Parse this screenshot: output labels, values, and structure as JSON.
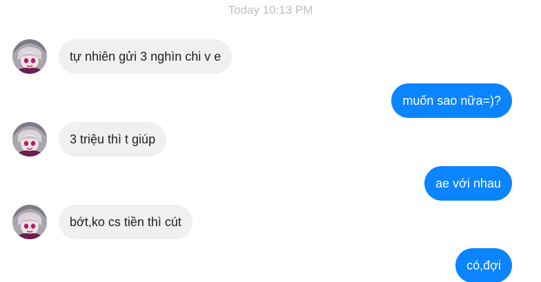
{
  "conversation": {
    "timestamp": "Today 10:13 PM",
    "colors": {
      "incoming_bubble": "#f1f0f0",
      "outgoing_bubble": "#0a84ff",
      "timestamp_text": "#bcc0c4"
    },
    "messages": [
      {
        "direction": "incoming",
        "text": "tự nhiên gửi 3 nghìn chi v e",
        "avatar_icon": "anime-avatar-icon"
      },
      {
        "direction": "outgoing",
        "text": "muốn sao nữa=)?"
      },
      {
        "direction": "incoming",
        "text": "3 triệu thì t giúp",
        "avatar_icon": "anime-avatar-icon"
      },
      {
        "direction": "outgoing",
        "text": "ae với nhau"
      },
      {
        "direction": "incoming",
        "text": "bớt,ko cs tiền thì cút",
        "avatar_icon": "anime-avatar-icon"
      },
      {
        "direction": "outgoing",
        "text": "có,đợi"
      }
    ]
  }
}
